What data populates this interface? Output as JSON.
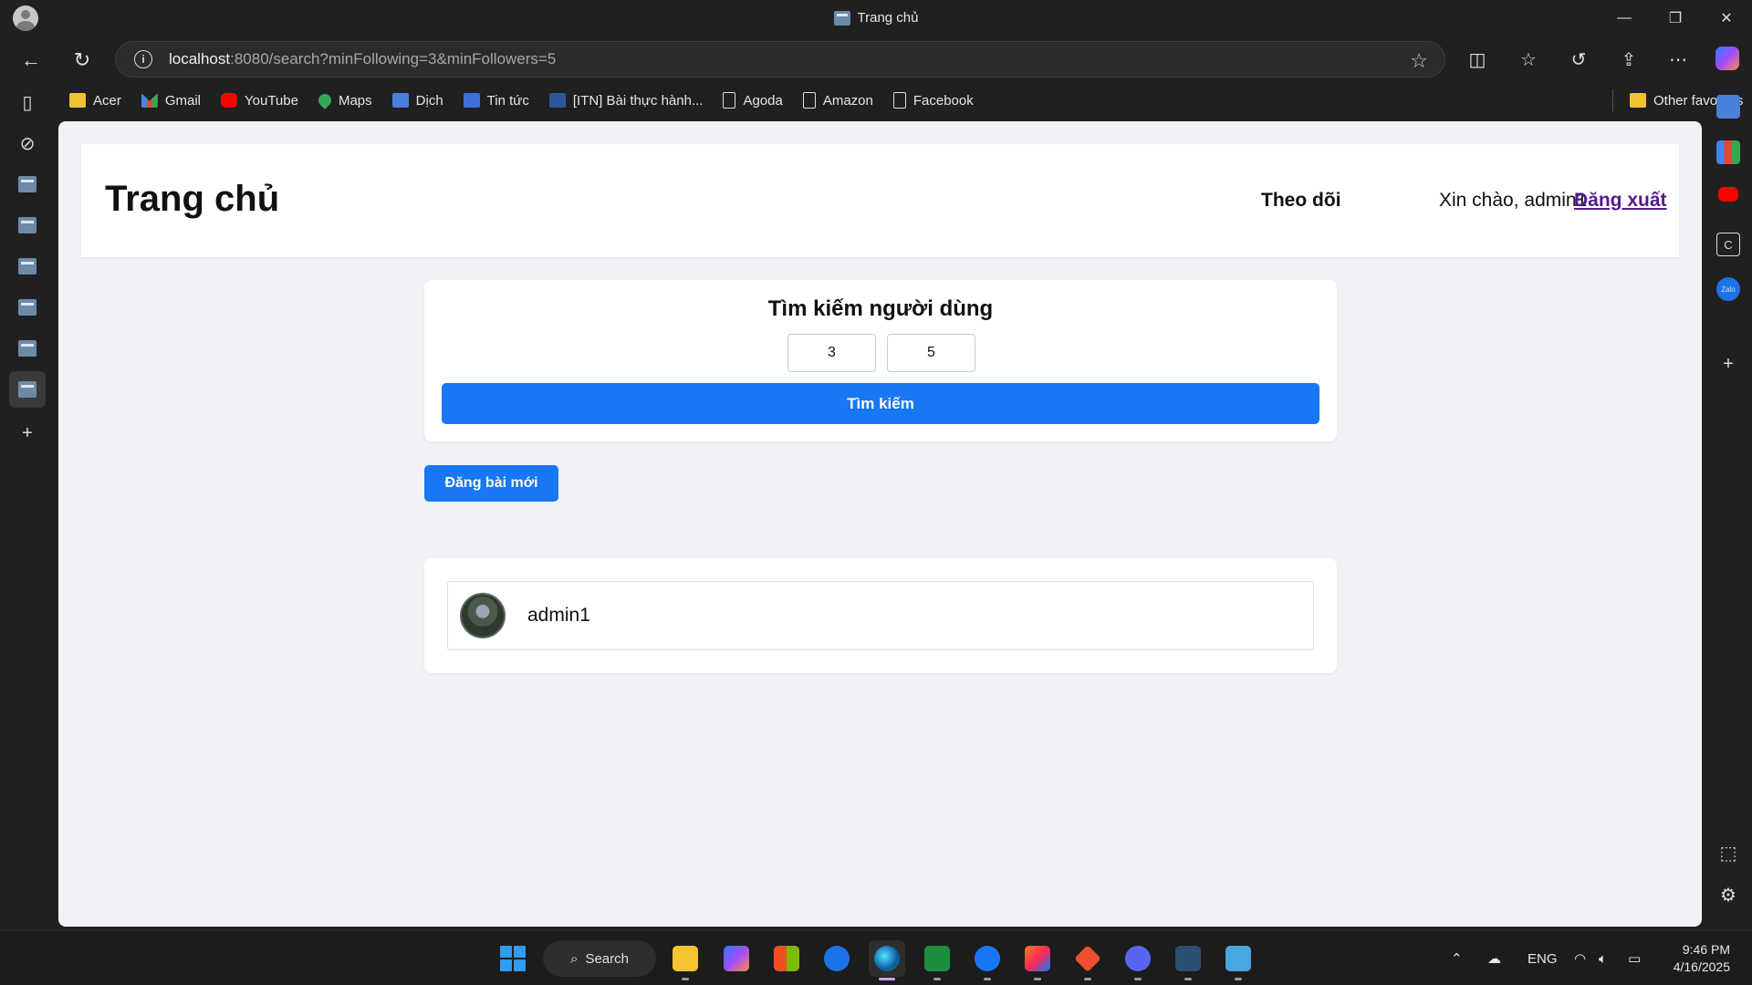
{
  "browser": {
    "window_title": "Trang chủ",
    "url_host": "localhost",
    "url_rest": ":8080/search?minFollowing=3&minFollowers=5",
    "bookmarks": [
      {
        "label": "Acer",
        "icon": "folder-icon"
      },
      {
        "label": "Gmail",
        "icon": "gmail-icon"
      },
      {
        "label": "YouTube",
        "icon": "youtube-icon"
      },
      {
        "label": "Maps",
        "icon": "maps-icon"
      },
      {
        "label": "Dịch",
        "icon": "translate-icon"
      },
      {
        "label": "Tin tức",
        "icon": "news-icon"
      },
      {
        "label": "[ITN] Bài thực hành...",
        "icon": "word-icon"
      },
      {
        "label": "Agoda",
        "icon": "page-icon"
      },
      {
        "label": "Amazon",
        "icon": "page-icon"
      },
      {
        "label": "Facebook",
        "icon": "page-icon"
      }
    ],
    "other_favorites": "Other favorites"
  },
  "page": {
    "title": "Trang chủ",
    "nav": {
      "follow": "Theo dõi",
      "greeting": "Xin chào, admin1",
      "logout": "Đăng xuất"
    },
    "search": {
      "heading": "Tìm kiếm người dùng",
      "min_following": "3",
      "min_followers": "5",
      "button": "Tìm kiếm"
    },
    "new_post_button": "Đăng bài mới",
    "results": [
      {
        "username": "admin1"
      }
    ]
  },
  "taskbar": {
    "search_label": "Search",
    "language": "ENG",
    "time": "9:46 PM",
    "date": "4/16/2025"
  },
  "colors": {
    "primary_button": "#1877f2",
    "page_background": "#f0f2f5",
    "logout_link": "#551a8b"
  }
}
